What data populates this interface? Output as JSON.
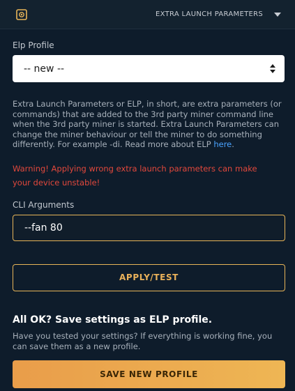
{
  "header": {
    "title": "EXTRA LAUNCH PARAMETERS",
    "icon": "elp-icon",
    "toggle_icon": "chevron-down-icon"
  },
  "profile": {
    "label": "Elp Profile",
    "selected": "-- new --"
  },
  "description": {
    "text": "Extra Launch Parameters or ELP, in short, are extra parameters (or commands) that are added to the 3rd party miner command line when the 3rd party miner is started. Extra Launch Parameters can change the miner behaviour or tell the miner to do something differently. For example -di. Read more about ELP ",
    "link": "here",
    "end": "."
  },
  "warning": "Warning! Applying wrong extra launch parameters can make your device unstable!",
  "cli": {
    "label": "CLI Arguments",
    "value": "--fan 80"
  },
  "apply_button": "APPLY/TEST",
  "save_section": {
    "title": "All OK? Save settings as ELP profile.",
    "text": "Have you tested your settings? If everything is working fine, you can save them as a new profile.",
    "button": "SAVE NEW PROFILE"
  },
  "colors": {
    "background": "#0e1c2b",
    "accent": "#e8b558",
    "warning": "#e2483c",
    "link": "#4aa3ff"
  }
}
